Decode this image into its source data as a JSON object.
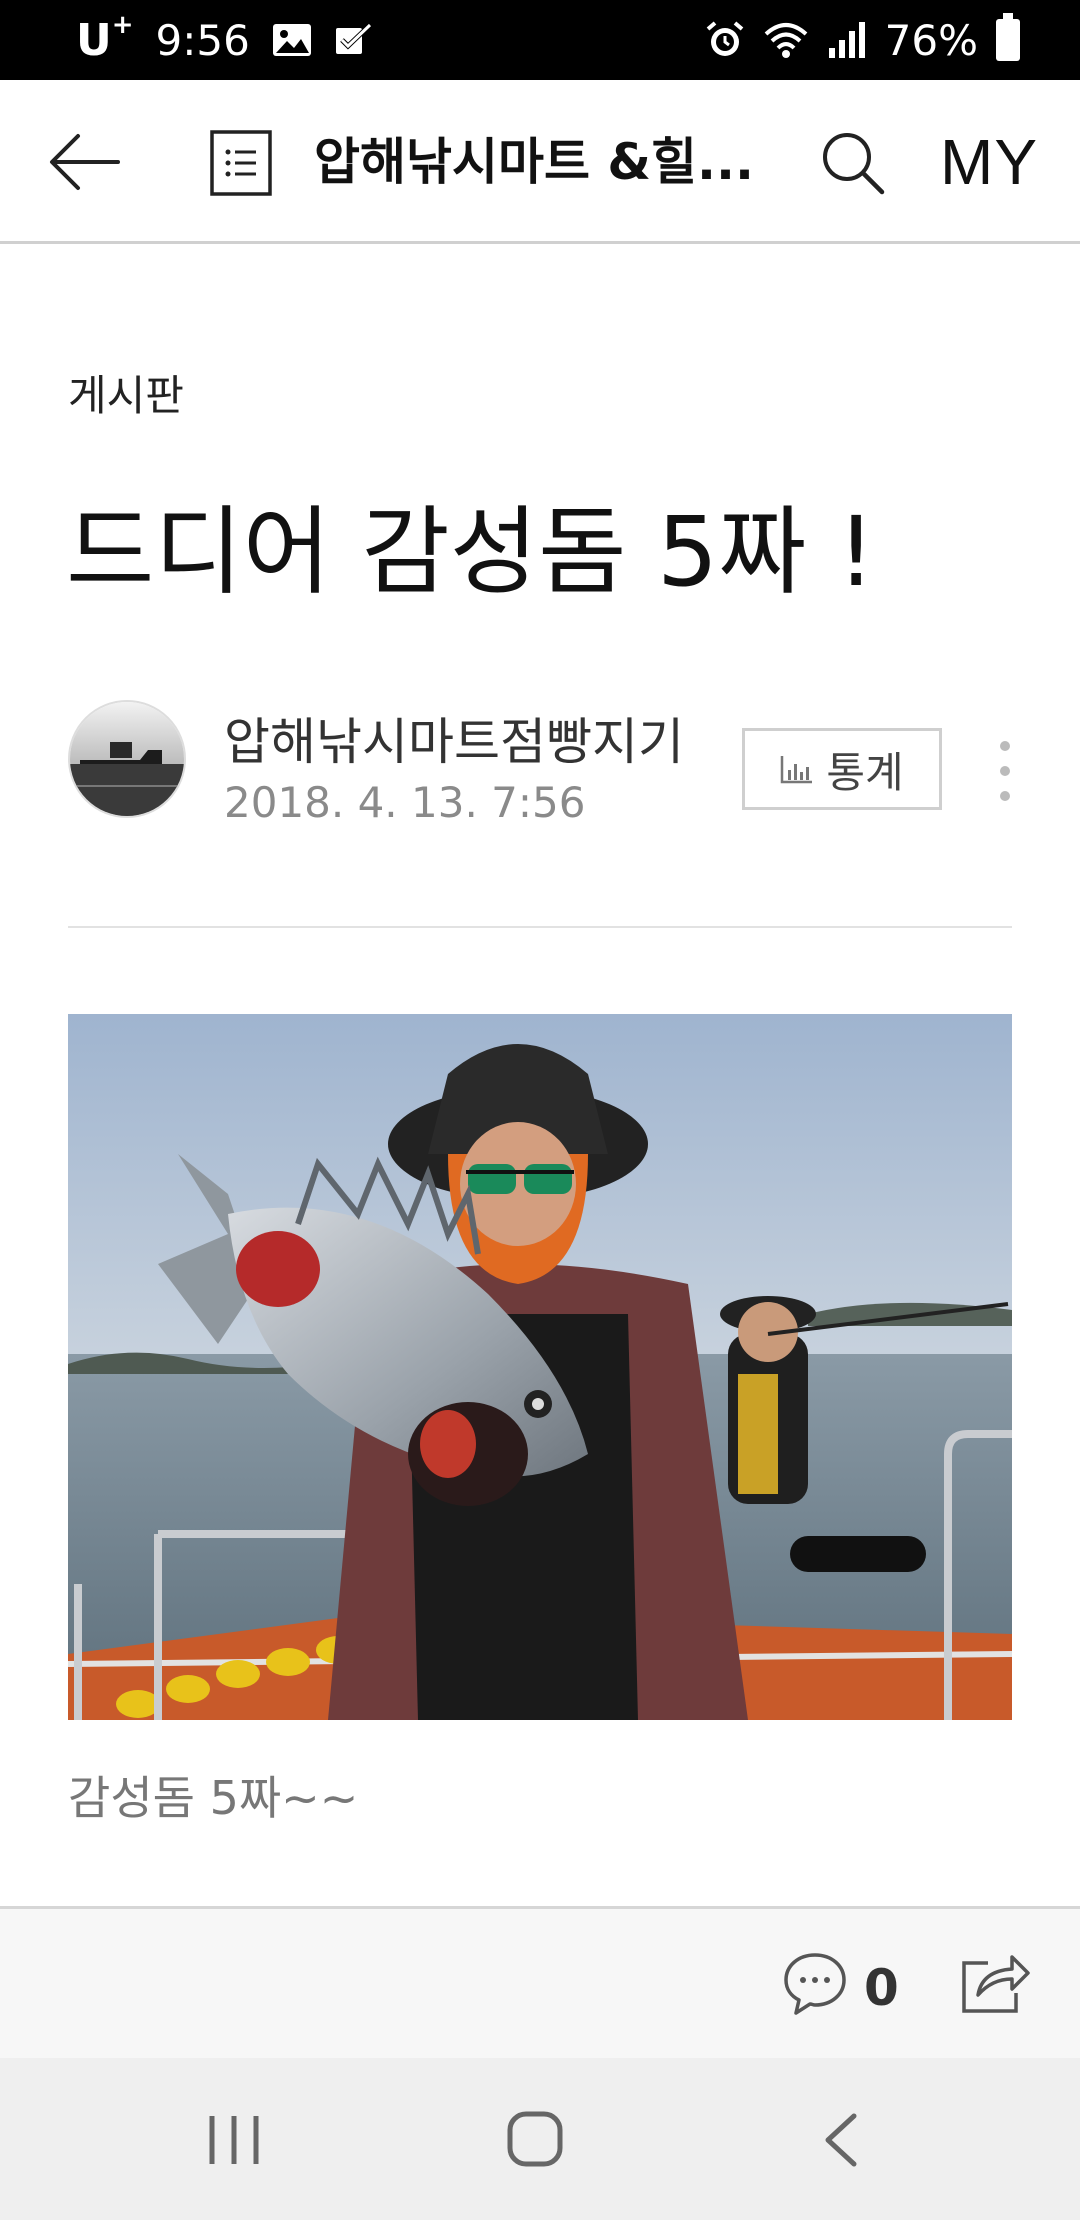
{
  "status_bar": {
    "carrier": "U",
    "carrier_sup": "+",
    "time": "9:56",
    "battery": "76%"
  },
  "header": {
    "title": "압해낚시마트 &힐...",
    "my_label": "MY"
  },
  "post": {
    "board": "게시판",
    "title": "드디어 감성돔 5짜 !",
    "author": "압해낚시마트점빵지기",
    "date": "2018. 4. 13. 7:56",
    "stats_label": "통계",
    "caption": "감성돔 5짜~~"
  },
  "actions": {
    "comment_count": "0"
  },
  "colors": {
    "status_bar_bg": "#000000",
    "divider": "#e2e2e2",
    "action_bar_bg": "#f7f7f7",
    "nav_bar_bg": "#efefef"
  },
  "icons": {
    "back": "back-arrow-icon",
    "list": "board-list-icon",
    "search": "search-icon",
    "stats": "bar-chart-icon",
    "more": "more-vertical-icon",
    "comment": "comment-bubble-icon",
    "share": "share-icon",
    "nav_recent": "recent-apps-icon",
    "nav_home": "home-icon",
    "nav_back": "nav-back-icon"
  }
}
